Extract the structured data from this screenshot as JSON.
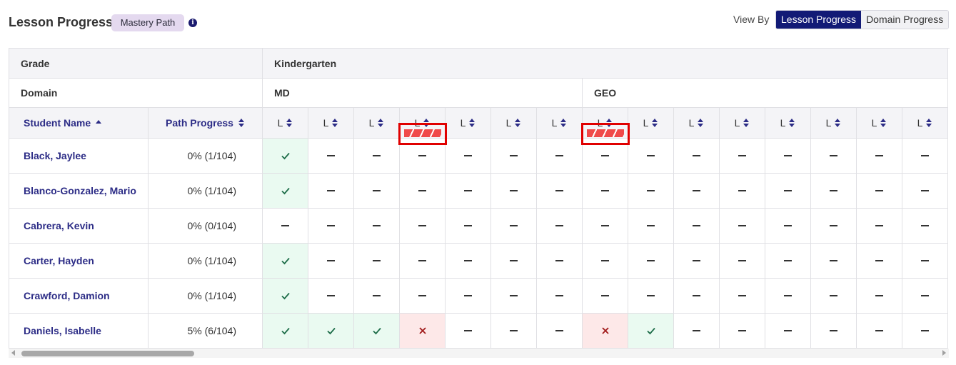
{
  "header": {
    "title": "Lesson Progress",
    "badge": "Mastery Path",
    "info_icon": "info-icon",
    "view_by_label": "View By",
    "view_options": [
      {
        "label": "Lesson Progress",
        "active": true
      },
      {
        "label": "Domain Progress",
        "active": false
      }
    ]
  },
  "grid": {
    "grade_label": "Grade",
    "grade_value": "Kindergarten",
    "domain_label": "Domain",
    "domains": [
      "MD",
      "GEO"
    ],
    "student_col": "Student Name",
    "progress_col": "Path Progress",
    "lesson_label": "L",
    "lesson_domains": [
      "MD",
      "MD",
      "MD",
      "MD",
      "MD",
      "MD",
      "MD",
      "GEO",
      "GEO",
      "GEO",
      "GEO",
      "GEO",
      "GEO",
      "GEO",
      "GEO"
    ],
    "highlighted_lessons": [
      3,
      7
    ],
    "students": [
      {
        "name": "Black, Jaylee",
        "progress": "0% (1/104)",
        "lessons": [
          "pass",
          "none",
          "none",
          "none",
          "none",
          "none",
          "none",
          "none",
          "none",
          "none",
          "none",
          "none",
          "none",
          "none",
          "none"
        ]
      },
      {
        "name": "Blanco-Gonzalez, Mario",
        "progress": "0% (1/104)",
        "lessons": [
          "pass",
          "none",
          "none",
          "none",
          "none",
          "none",
          "none",
          "none",
          "none",
          "none",
          "none",
          "none",
          "none",
          "none",
          "none"
        ]
      },
      {
        "name": "Cabrera, Kevin",
        "progress": "0% (0/104)",
        "lessons": [
          "none",
          "none",
          "none",
          "none",
          "none",
          "none",
          "none",
          "none",
          "none",
          "none",
          "none",
          "none",
          "none",
          "none",
          "none"
        ]
      },
      {
        "name": "Carter, Hayden",
        "progress": "0% (1/104)",
        "lessons": [
          "pass",
          "none",
          "none",
          "none",
          "none",
          "none",
          "none",
          "none",
          "none",
          "none",
          "none",
          "none",
          "none",
          "none",
          "none"
        ]
      },
      {
        "name": "Crawford, Damion",
        "progress": "0% (1/104)",
        "lessons": [
          "pass",
          "none",
          "none",
          "none",
          "none",
          "none",
          "none",
          "none",
          "none",
          "none",
          "none",
          "none",
          "none",
          "none",
          "none"
        ]
      },
      {
        "name": "Daniels, Isabelle",
        "progress": "5% (6/104)",
        "lessons": [
          "pass",
          "pass",
          "pass",
          "fail",
          "none",
          "none",
          "none",
          "fail",
          "pass",
          "none",
          "none",
          "none",
          "none",
          "none",
          "none"
        ]
      }
    ]
  },
  "icons": {
    "pass": "checkmark-icon",
    "fail": "x-icon",
    "none": "dash-icon",
    "sort_asc": "sort-ascending-icon",
    "sort": "sort-icon"
  },
  "colors": {
    "brand_navy": "#121a76",
    "link": "#2c2c86",
    "pass_bg": "#eafaf1",
    "pass_mark": "#1f6e4a",
    "fail_bg": "#fde8e8",
    "fail_mark": "#a11a1a",
    "badge_bg": "#e4d9ef",
    "highlight": "#e00000"
  }
}
